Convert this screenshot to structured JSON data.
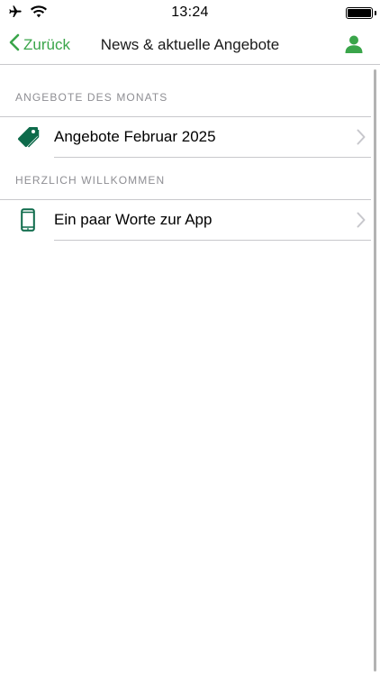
{
  "status_bar": {
    "time": "13:24",
    "icons": [
      "airplane-icon",
      "wifi-icon",
      "battery-icon"
    ]
  },
  "nav": {
    "back_label": "Zurück",
    "title": "News & aktuelle Angebote",
    "user_icon": "user-icon"
  },
  "sections": [
    {
      "header": "ANGEBOTE DES MONATS",
      "items": [
        {
          "label": "Angebote Februar 2025",
          "icon": "tag-icon"
        }
      ]
    },
    {
      "header": "HERZLICH WILLKOMMEN",
      "items": [
        {
          "label": "Ein paar Worte zur App",
          "icon": "smartphone-icon"
        }
      ]
    }
  ],
  "colors": {
    "accent_green": "#3aa54a",
    "icon_dark_green": "#0e6b4b",
    "separator": "#c8c8cc",
    "section_header": "#8e8e93",
    "chevron": "#c7c7cc"
  }
}
